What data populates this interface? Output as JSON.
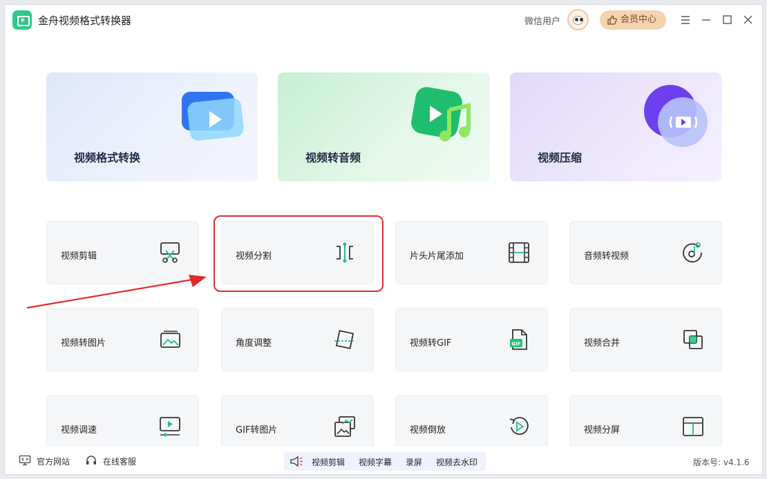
{
  "app": {
    "title": "金舟视频格式转换器",
    "user_name": "微信用户",
    "vip_label": "会员中心"
  },
  "feature_cards": [
    {
      "label": "视频格式转换",
      "icon": "video-play-icon"
    },
    {
      "label": "视频转音频",
      "icon": "music-note-icon"
    },
    {
      "label": "视频压缩",
      "icon": "compress-icon"
    }
  ],
  "tools": [
    {
      "label": "视频剪辑",
      "icon": "scissors-icon"
    },
    {
      "label": "视频分割",
      "icon": "split-icon"
    },
    {
      "label": "片头片尾添加",
      "icon": "film-strip-icon"
    },
    {
      "label": "音频转视频",
      "icon": "music-disc-icon"
    },
    {
      "label": "视频转图片",
      "icon": "image-icon"
    },
    {
      "label": "角度调整",
      "icon": "rotate-crop-icon"
    },
    {
      "label": "视频转GIF",
      "icon": "gif-file-icon"
    },
    {
      "label": "视频合并",
      "icon": "merge-icon"
    },
    {
      "label": "视频调速",
      "icon": "speed-icon"
    },
    {
      "label": "GIF转图片",
      "icon": "gif-image-icon"
    },
    {
      "label": "视频倒放",
      "icon": "reverse-icon"
    },
    {
      "label": "视频分屏",
      "icon": "split-screen-icon"
    }
  ],
  "footer": {
    "website": "官方网站",
    "service": "在线客服",
    "quick": [
      "视频剪辑",
      "视频字幕",
      "录屏",
      "视频去水印"
    ],
    "version": "版本号: v4.1.6"
  },
  "colors": {
    "accent_green": "#2ec98a",
    "highlight_red": "#e02b2b",
    "vip_bg": "#f3d3b0"
  }
}
